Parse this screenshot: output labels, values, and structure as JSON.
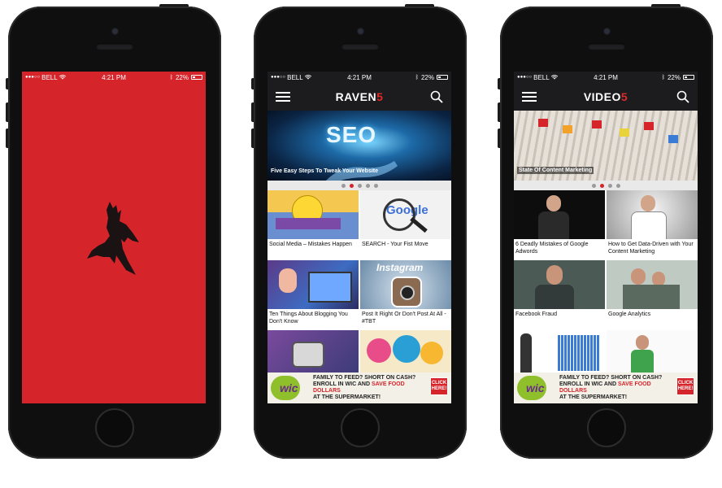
{
  "status": {
    "carrier": "BELL",
    "time": "4:21 PM",
    "battery": "22%"
  },
  "phone2": {
    "title_main": "RAVEN",
    "title_num": "5",
    "hero_caption": "Five Easy Steps To Tweak Your Website",
    "hero_text": "SEO",
    "tiles": [
      {
        "caption": "Social Media – Mistakes Happen"
      },
      {
        "caption": "SEARCH - Your Fist Move",
        "img_text": "Google"
      },
      {
        "caption": "Ten Things About Blogging You Don't Know"
      },
      {
        "caption": "Post It Right Or Don't Post At All - #TBT",
        "img_text": "Instagram"
      }
    ]
  },
  "phone3": {
    "title_main": "VIDEO",
    "title_num": "5",
    "hero_caption": "State Of Content Marketing",
    "tiles": [
      {
        "caption": "6 Deadly Mistakes of Google Adwords"
      },
      {
        "caption": "How to Get Data-Driven with Your Content Marketing"
      },
      {
        "caption": "Facebook Fraud"
      },
      {
        "caption": "Google Analytics"
      }
    ]
  },
  "ad": {
    "brand": "wic",
    "line1": "FAMILY TO FEED? SHORT ON CASH?",
    "line2a": "ENROLL IN WIC AND ",
    "line2b": "SAVE FOOD DOLLARS",
    "line3": "AT THE SUPERMARKET!",
    "cta": "CLICK HERE!"
  },
  "colors": {
    "brand_red": "#d6242b",
    "appbar": "#1c1c1e"
  }
}
